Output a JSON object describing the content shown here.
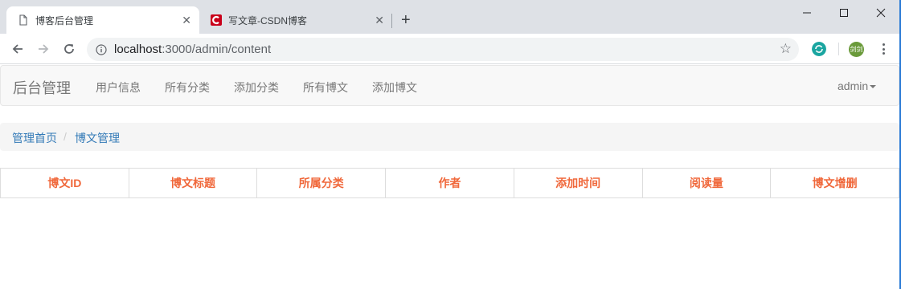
{
  "browser": {
    "tabs": [
      {
        "title": "博客后台管理",
        "active": true
      },
      {
        "title": "写文章-CSDN博客",
        "active": false
      }
    ],
    "new_tab_label": "+",
    "window_controls": {
      "minimize": "—",
      "maximize": "☐",
      "close": "✕"
    },
    "address": {
      "host": "localhost",
      "path": ":3000/admin/content"
    },
    "avatar_text": "剑剑",
    "colors": {
      "csdn": "#c9001a",
      "ext_sync": "#1aa5a0",
      "avatar": "#6a9a3a"
    }
  },
  "navbar": {
    "brand": "后台管理",
    "links": [
      "用户信息",
      "所有分类",
      "添加分类",
      "所有博文",
      "添加博文"
    ],
    "user": "admin"
  },
  "breadcrumb": {
    "items": [
      "管理首页",
      "博文管理"
    ],
    "separator": "/"
  },
  "table": {
    "headers": [
      "博文ID",
      "博文标题",
      "所属分类",
      "作者",
      "添加时间",
      "阅读量",
      "博文增删"
    ],
    "rows": []
  }
}
